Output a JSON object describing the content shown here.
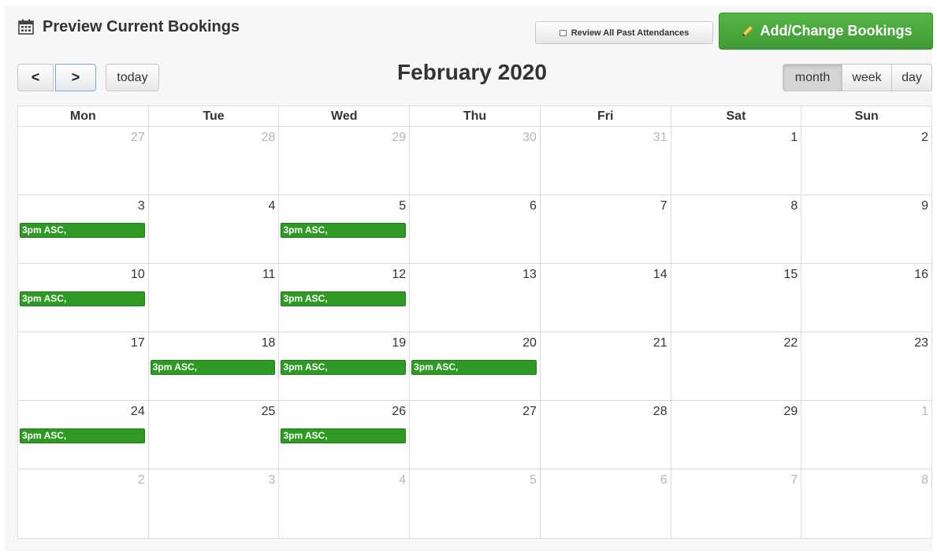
{
  "header": {
    "title": "Preview Current Bookings",
    "title_icon": "calendar-icon",
    "review_button": "Review All Past Attendances",
    "review_icon": "document-icon",
    "add_button": "Add/Change Bookings",
    "add_icon": "pencil-icon",
    "add_color": "#4caf41"
  },
  "toolbar": {
    "prev": "<",
    "next": ">",
    "today": "today",
    "title": "February 2020",
    "views": [
      "month",
      "week",
      "day"
    ],
    "active_view": "month"
  },
  "calendar": {
    "weekdays": [
      "Mon",
      "Tue",
      "Wed",
      "Thu",
      "Fri",
      "Sat",
      "Sun"
    ],
    "event_color": "#2e9a24",
    "weeks": [
      [
        {
          "num": "27",
          "other": true
        },
        {
          "num": "28",
          "other": true
        },
        {
          "num": "29",
          "other": true
        },
        {
          "num": "30",
          "other": true
        },
        {
          "num": "31",
          "other": true
        },
        {
          "num": "1",
          "other": false
        },
        {
          "num": "2",
          "other": false
        }
      ],
      [
        {
          "num": "3",
          "other": false,
          "event": "3pm ASC,"
        },
        {
          "num": "4",
          "other": false
        },
        {
          "num": "5",
          "other": false,
          "event": "3pm ASC,"
        },
        {
          "num": "6",
          "other": false
        },
        {
          "num": "7",
          "other": false
        },
        {
          "num": "8",
          "other": false
        },
        {
          "num": "9",
          "other": false
        }
      ],
      [
        {
          "num": "10",
          "other": false,
          "event": "3pm ASC,"
        },
        {
          "num": "11",
          "other": false
        },
        {
          "num": "12",
          "other": false,
          "event": "3pm ASC,"
        },
        {
          "num": "13",
          "other": false
        },
        {
          "num": "14",
          "other": false
        },
        {
          "num": "15",
          "other": false
        },
        {
          "num": "16",
          "other": false
        }
      ],
      [
        {
          "num": "17",
          "other": false
        },
        {
          "num": "18",
          "other": false,
          "event": "3pm ASC,"
        },
        {
          "num": "19",
          "other": false,
          "event": "3pm ASC,"
        },
        {
          "num": "20",
          "other": false,
          "event": "3pm ASC,"
        },
        {
          "num": "21",
          "other": false
        },
        {
          "num": "22",
          "other": false
        },
        {
          "num": "23",
          "other": false
        }
      ],
      [
        {
          "num": "24",
          "other": false,
          "event": "3pm ASC,"
        },
        {
          "num": "25",
          "other": false
        },
        {
          "num": "26",
          "other": false,
          "event": "3pm ASC,"
        },
        {
          "num": "27",
          "other": false
        },
        {
          "num": "28",
          "other": false
        },
        {
          "num": "29",
          "other": false
        },
        {
          "num": "1",
          "other": true
        }
      ],
      [
        {
          "num": "2",
          "other": true
        },
        {
          "num": "3",
          "other": true
        },
        {
          "num": "4",
          "other": true
        },
        {
          "num": "5",
          "other": true
        },
        {
          "num": "6",
          "other": true
        },
        {
          "num": "7",
          "other": true
        },
        {
          "num": "8",
          "other": true
        }
      ]
    ]
  }
}
